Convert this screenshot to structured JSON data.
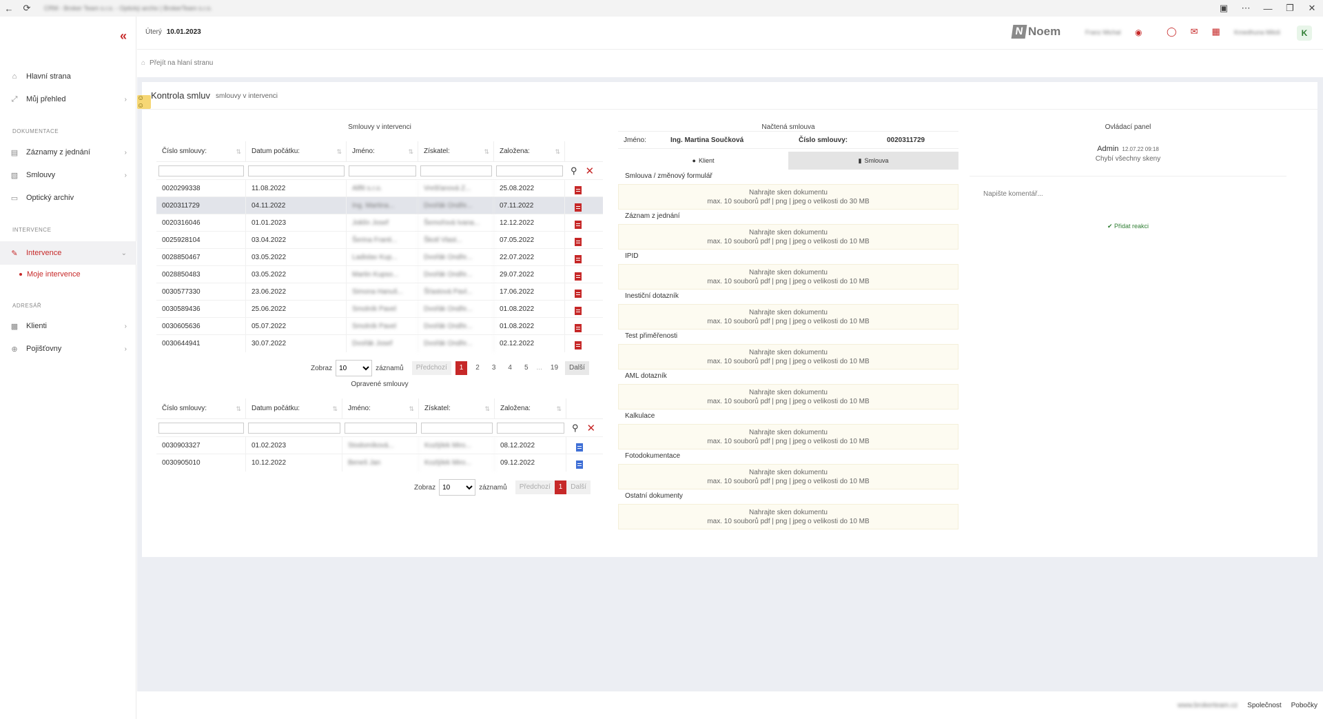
{
  "titlebar": {
    "title": "CRM - Broker Team s.r.o. - Optický archiv | BrokerTeam s.r.o."
  },
  "sidebar": {
    "items": [
      {
        "label": "Hlavní strana",
        "icon": "home-icon"
      },
      {
        "label": "Můj přehled",
        "icon": "expand-icon"
      },
      {
        "label": "Záznamy z jednání",
        "icon": "document-icon"
      },
      {
        "label": "Smlouvy",
        "icon": "wallet-icon"
      },
      {
        "label": "Optický archiv",
        "icon": "folder-icon"
      },
      {
        "label": "Intervence",
        "icon": "intervention-icon"
      },
      {
        "label": "Klienti",
        "icon": "bank-icon"
      },
      {
        "label": "Pojišťovny",
        "icon": "globe-icon"
      }
    ],
    "sections": [
      "DOKUMENTACE",
      "INTERVENCE",
      "ADRESÁŘ"
    ],
    "sub_item": "Moje intervence"
  },
  "header": {
    "day": "Úterý",
    "date": "10.01.2023",
    "logo": "Noem",
    "user_blurred": "Franz Michal",
    "user2_blurred": "Kmedhuna Miloš",
    "avatar": "K"
  },
  "breadcrumb": "Přejít na hlaní stranu",
  "page": {
    "title": "Kontrola smluv",
    "subtitle": "smlouvy v intervenci"
  },
  "table1": {
    "title": "Smlouvy v intervenci",
    "columns": [
      "Číslo smlouvy:",
      "Datum počátku:",
      "Jméno:",
      "Získatel:",
      "Založena:"
    ],
    "rows": [
      [
        "0020299338",
        "11.08.2022",
        "Allfit s.r.o.",
        "Vrešťanová Z...",
        "25.08.2022"
      ],
      [
        "0020311729",
        "04.11.2022",
        "Ing. Martina...",
        "Dvořák Ondře...",
        "07.11.2022"
      ],
      [
        "0020316046",
        "01.01.2023",
        "Joklín Josef",
        "Šemořová Ivana...",
        "12.12.2022"
      ],
      [
        "0025928104",
        "03.04.2022",
        "Šerina Franti...",
        "Škotl Vlast...",
        "07.05.2022"
      ],
      [
        "0028850467",
        "03.05.2022",
        "Ladislav Kup...",
        "Dvořák Ondře...",
        "22.07.2022"
      ],
      [
        "0028850483",
        "03.05.2022",
        "Martin Kupso...",
        "Dvořák Ondře...",
        "29.07.2022"
      ],
      [
        "0030577330",
        "23.06.2022",
        "Simona Hanuš...",
        "Šťastová Pavl...",
        "17.06.2022"
      ],
      [
        "0030589436",
        "25.06.2022",
        "Smolník Pavel",
        "Dvořák Ondře...",
        "01.08.2022"
      ],
      [
        "0030605636",
        "05.07.2022",
        "Smolník Pavel",
        "Dvořák Ondře...",
        "01.08.2022"
      ],
      [
        "0030644941",
        "30.07.2022",
        "Dvořák Josef",
        "Dvořák Ondře...",
        "02.12.2022"
      ]
    ],
    "pager": {
      "show_label": "Zobraz",
      "per_page": "10",
      "records_label": "záznamů",
      "prev": "Předchozí",
      "pages": [
        "1",
        "2",
        "3",
        "4",
        "5",
        "...",
        "19"
      ],
      "next": "Další"
    }
  },
  "table2": {
    "title": "Opravené smlouvy",
    "columns": [
      "Číslo smlouvy:",
      "Datum počátku:",
      "Jméno:",
      "Získatel:",
      "Založena:"
    ],
    "rows": [
      [
        "0030903327",
        "01.02.2023",
        "Stodomíková...",
        "Kozlýlek Miro...",
        "08.12.2022"
      ],
      [
        "0030905010",
        "10.12.2022",
        "Beneš Jan",
        "Kozlýlek Miro...",
        "09.12.2022"
      ]
    ],
    "pager": {
      "show_label": "Zobraz",
      "per_page": "10",
      "records_label": "záznamů",
      "prev": "Předchozí",
      "pages": [
        "1"
      ],
      "next": "Další"
    }
  },
  "loaded_contract": {
    "title": "Načtená smlouva",
    "name_label": "Jméno:",
    "name_value": "Ing. Martina Součková",
    "number_label": "Číslo smlouvy:",
    "number_value": "0020311729",
    "tab_client": "Klient",
    "tab_contract": "Smlouva",
    "documents": [
      {
        "label": "Smlouva / změnový formulář",
        "line1": "Nahrajte sken dokumentu",
        "line2": "max. 10 souborů pdf | png | jpeg o velikosti do 30 MB"
      },
      {
        "label": "Záznam z jednání",
        "line1": "Nahrajte sken dokumentu",
        "line2": "max. 10 souborů pdf | png | jpeg o velikosti do 10 MB"
      },
      {
        "label": "IPID",
        "line1": "Nahrajte sken dokumentu",
        "line2": "max. 10 souborů pdf | png | jpeg o velikosti do 10 MB"
      },
      {
        "label": "Inestiční dotazník",
        "line1": "Nahrajte sken dokumentu",
        "line2": "max. 10 souborů pdf | png | jpeg o velikosti do 10 MB"
      },
      {
        "label": "Test přiměřenosti",
        "line1": "Nahrajte sken dokumentu",
        "line2": "max. 10 souborů pdf | png | jpeg o velikosti do 10 MB"
      },
      {
        "label": "AML dotazník",
        "line1": "Nahrajte sken dokumentu",
        "line2": "max. 10 souborů pdf | png | jpeg o velikosti do 10 MB"
      },
      {
        "label": "Kalkulace",
        "line1": "Nahrajte sken dokumentu",
        "line2": "max. 10 souborů pdf | png | jpeg o velikosti do 10 MB"
      },
      {
        "label": "Fotodokumentace",
        "line1": "Nahrajte sken dokumentu",
        "line2": "max. 10 souborů pdf | png | jpeg o velikosti do 10 MB"
      },
      {
        "label": "Ostatní dokumenty",
        "line1": "Nahrajte sken dokumentu",
        "line2": "max. 10 souborů pdf | png | jpeg o velikosti do 10 MB"
      }
    ]
  },
  "control_panel": {
    "title": "Ovládací panel",
    "author": "Admin",
    "timestamp": "12.07.22 09:18",
    "message": "Chybí všechny skeny",
    "comment_placeholder": "Napište komentář...",
    "add_reaction": "Přidat reakci"
  },
  "footer": {
    "site": "www.brokerteam.cz",
    "company": "Společnost",
    "branches": "Pobočky"
  },
  "colors": {
    "accent": "#c62828",
    "badge": "#f6d775",
    "upload_bg": "#fdfbf1",
    "success": "#2e7d32"
  }
}
